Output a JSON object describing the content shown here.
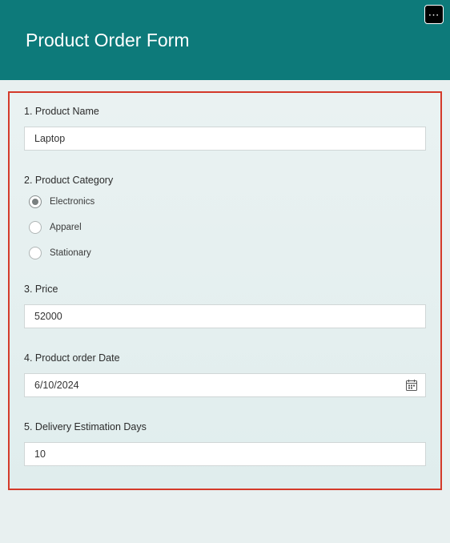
{
  "header": {
    "title": "Product Order Form"
  },
  "questions": {
    "q1": {
      "number": "1.",
      "label": "Product Name",
      "value": "Laptop"
    },
    "q2": {
      "number": "2.",
      "label": "Product Category",
      "options": [
        {
          "label": "Electronics",
          "selected": true
        },
        {
          "label": "Apparel",
          "selected": false
        },
        {
          "label": "Stationary",
          "selected": false
        }
      ]
    },
    "q3": {
      "number": "3.",
      "label": "Price",
      "value": "52000"
    },
    "q4": {
      "number": "4.",
      "label": "Product order Date",
      "value": "6/10/2024"
    },
    "q5": {
      "number": "5.",
      "label": "Delivery Estimation Days",
      "value": "10"
    }
  }
}
